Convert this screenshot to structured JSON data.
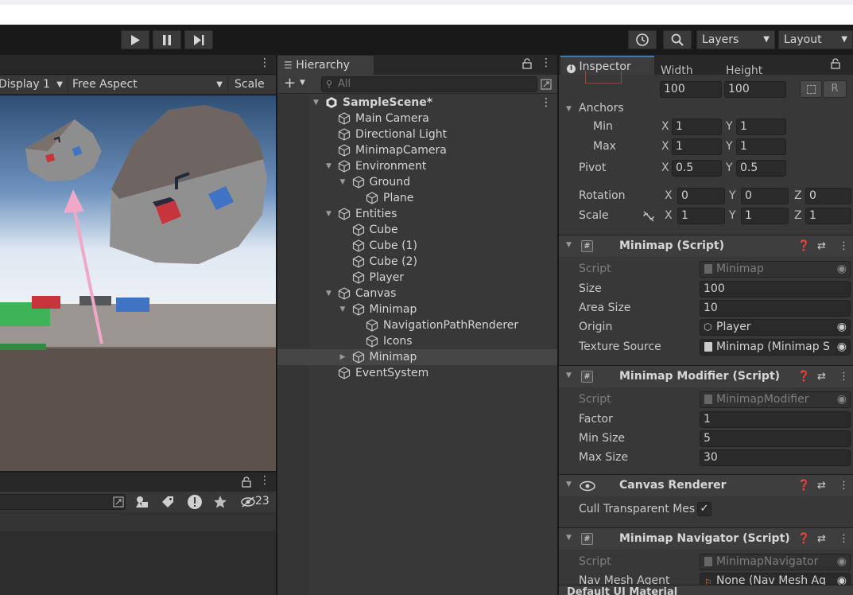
{
  "toolbar": {
    "layers": "Layers",
    "layout": "Layout"
  },
  "game": {
    "display": "Display 1",
    "aspect": "Free Aspect",
    "scale": "Scale"
  },
  "console": {
    "count": "23"
  },
  "hierarchy": {
    "tab": "Hierarchy",
    "search_placeholder": "All",
    "items": [
      {
        "label": "SampleScene*",
        "depth": 0,
        "fold": "down"
      },
      {
        "label": "Main Camera",
        "depth": 1,
        "fold": ""
      },
      {
        "label": "Directional Light",
        "depth": 1,
        "fold": ""
      },
      {
        "label": "MinimapCamera",
        "depth": 1,
        "fold": ""
      },
      {
        "label": "Environment",
        "depth": 1,
        "fold": "down"
      },
      {
        "label": "Ground",
        "depth": 2,
        "fold": "down"
      },
      {
        "label": "Plane",
        "depth": 3,
        "fold": ""
      },
      {
        "label": "Entities",
        "depth": 1,
        "fold": "down"
      },
      {
        "label": "Cube",
        "depth": 2,
        "fold": ""
      },
      {
        "label": "Cube (1)",
        "depth": 2,
        "fold": ""
      },
      {
        "label": "Cube (2)",
        "depth": 2,
        "fold": ""
      },
      {
        "label": "Player",
        "depth": 2,
        "fold": ""
      },
      {
        "label": "Canvas",
        "depth": 1,
        "fold": "down"
      },
      {
        "label": "Minimap",
        "depth": 2,
        "fold": "down"
      },
      {
        "label": "NavigationPathRenderer",
        "depth": 3,
        "fold": ""
      },
      {
        "label": "Icons",
        "depth": 3,
        "fold": ""
      },
      {
        "label": "Minimap",
        "depth": 2,
        "fold": "right",
        "selected": true
      },
      {
        "label": "EventSystem",
        "depth": 1,
        "fold": ""
      }
    ]
  },
  "inspector": {
    "tab": "Inspector",
    "rect": {
      "width_label": "Width",
      "height_label": "Height",
      "width": "100",
      "height": "100",
      "r": "R"
    },
    "anchors": {
      "label": "Anchors",
      "min_label": "Min",
      "max_label": "Max",
      "min_x": "1",
      "min_y": "1",
      "max_x": "1",
      "max_y": "1"
    },
    "pivot": {
      "label": "Pivot",
      "x": "0.5",
      "y": "0.5"
    },
    "rotation": {
      "label": "Rotation",
      "x": "0",
      "y": "0",
      "z": "0"
    },
    "scale": {
      "label": "Scale",
      "x": "1",
      "y": "1",
      "z": "1"
    },
    "axes": {
      "x": "X",
      "y": "Y",
      "z": "Z"
    },
    "minimap": {
      "title": "Minimap (Script)",
      "script_label": "Script",
      "script": "Minimap",
      "size_label": "Size",
      "size": "100",
      "area_label": "Area Size",
      "area": "10",
      "origin_label": "Origin",
      "origin": "Player",
      "texture_label": "Texture Source",
      "texture": "Minimap (Minimap S"
    },
    "modifier": {
      "title": "Minimap Modifier (Script)",
      "script_label": "Script",
      "script": "MinimapModifier",
      "factor_label": "Factor",
      "factor": "1",
      "min_label": "Min Size",
      "min": "5",
      "max_label": "Max Size",
      "max": "30"
    },
    "canvas": {
      "title": "Canvas Renderer",
      "cull_label": "Cull Transparent Mes",
      "check": "✓"
    },
    "navigator": {
      "title": "Minimap Navigator (Script)",
      "script_label": "Script",
      "script": "MinimapNavigator",
      "agent_label": "Nav Mesh Agent",
      "agent": "None (Nav Mesh Ag"
    },
    "material": "Default UI Material"
  }
}
